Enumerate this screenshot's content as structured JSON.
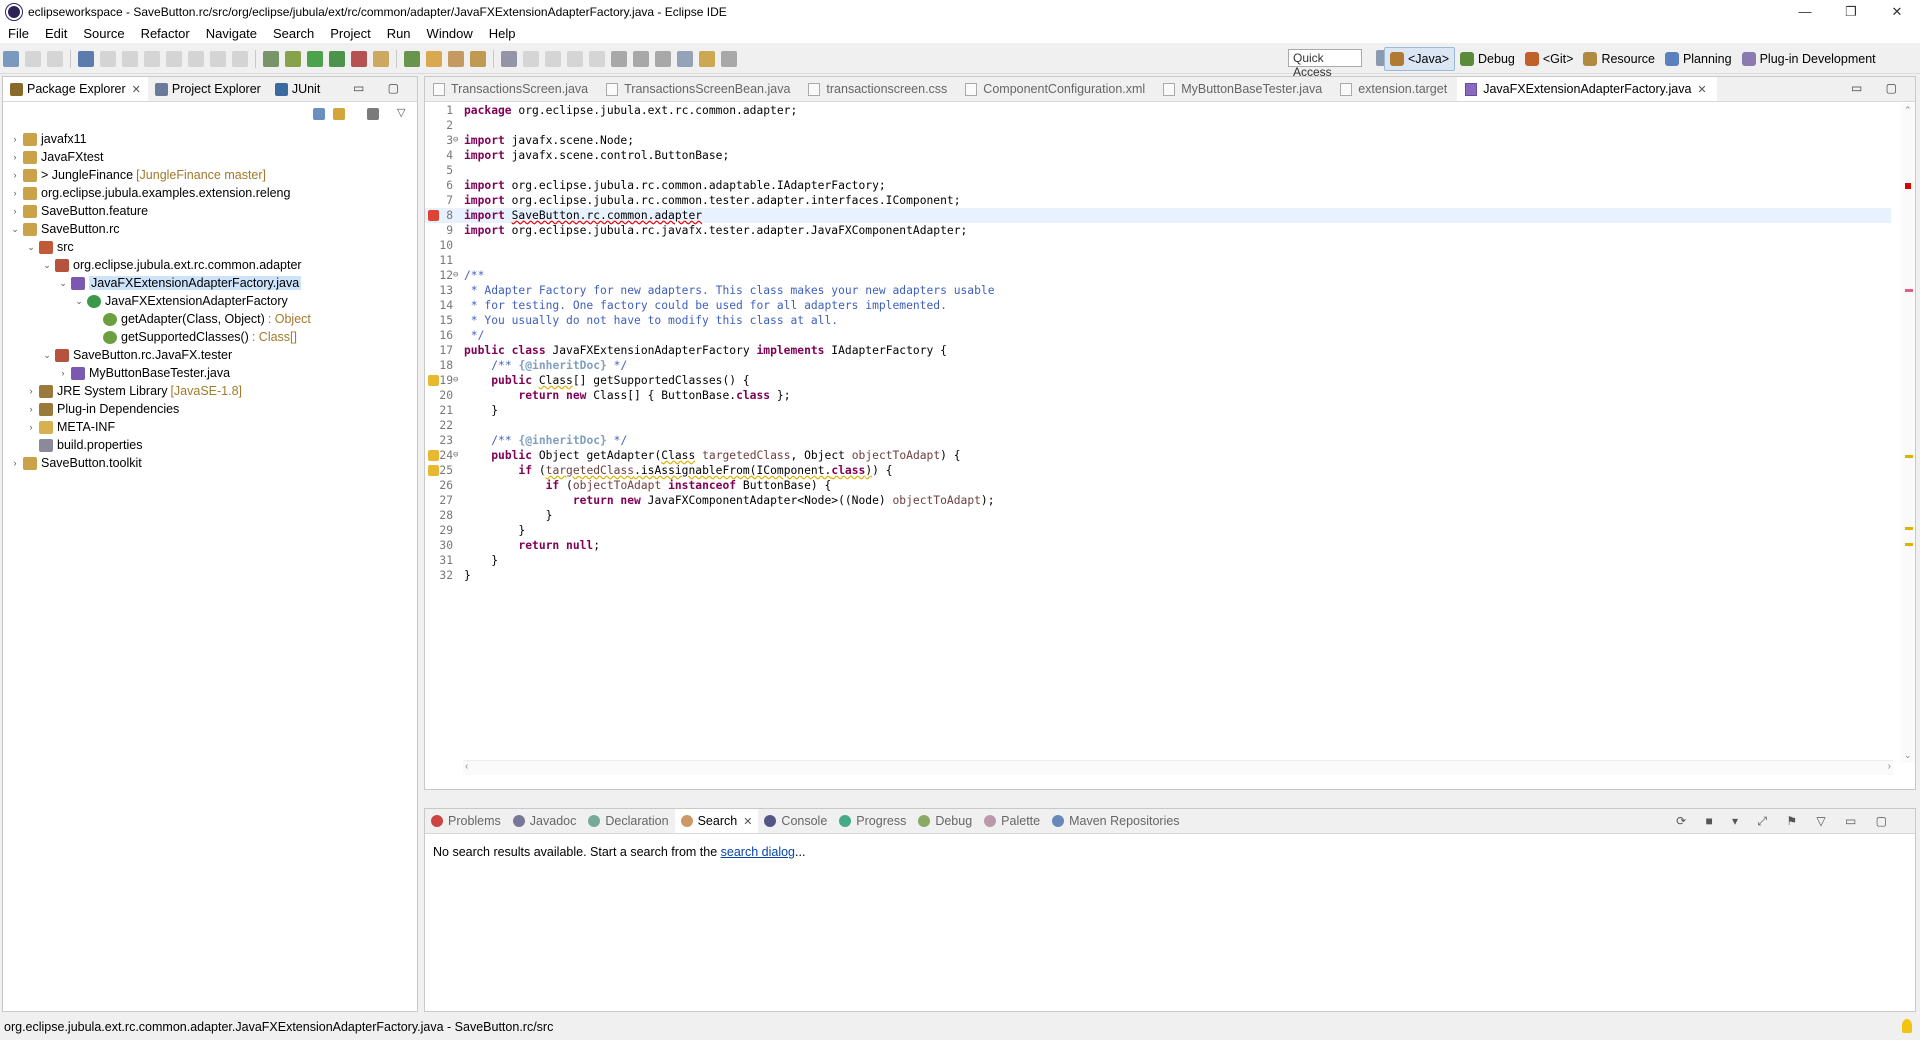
{
  "window": {
    "title": "eclipseworkspace - SaveButton.rc/src/org/eclipse/jubula/ext/rc/common/adapter/JavaFXExtensionAdapterFactory.java - Eclipse IDE"
  },
  "menu": [
    "File",
    "Edit",
    "Source",
    "Refactor",
    "Navigate",
    "Search",
    "Project",
    "Run",
    "Window",
    "Help"
  ],
  "quick_access": "Quick Access",
  "perspectives": [
    {
      "label": "<Java>",
      "icon": "java-perspective-icon",
      "active": true
    },
    {
      "label": "Debug",
      "icon": "debug-perspective-icon",
      "active": false
    },
    {
      "label": "<Git>",
      "icon": "git-perspective-icon",
      "active": false
    },
    {
      "label": "Resource",
      "icon": "resource-perspective-icon",
      "active": false
    },
    {
      "label": "Planning",
      "icon": "planning-perspective-icon",
      "active": false
    },
    {
      "label": "Plug-in Development",
      "icon": "plugin-perspective-icon",
      "active": false
    }
  ],
  "left_tabs": [
    {
      "label": "Package Explorer",
      "active": true,
      "close": "✕"
    },
    {
      "label": "Project Explorer",
      "active": false,
      "close": ""
    },
    {
      "label": "JUnit",
      "active": false,
      "close": ""
    }
  ],
  "tree": [
    {
      "depth": 0,
      "arrow": "›",
      "icon": "project",
      "label": "javafx11",
      "suffix": ""
    },
    {
      "depth": 0,
      "arrow": "›",
      "icon": "project",
      "label": "JavaFXtest",
      "suffix": ""
    },
    {
      "depth": 0,
      "arrow": "›",
      "icon": "project",
      "label": "> JungleFinance",
      "suffix": "[JungleFinance master]"
    },
    {
      "depth": 0,
      "arrow": "›",
      "icon": "project",
      "label": "org.eclipse.jubula.examples.extension.releng",
      "suffix": ""
    },
    {
      "depth": 0,
      "arrow": "›",
      "icon": "project",
      "label": "SaveButton.feature",
      "suffix": ""
    },
    {
      "depth": 0,
      "arrow": "⌄",
      "icon": "project",
      "label": "SaveButton.rc",
      "suffix": ""
    },
    {
      "depth": 1,
      "arrow": "⌄",
      "icon": "srcfolder",
      "label": "src",
      "suffix": ""
    },
    {
      "depth": 2,
      "arrow": "⌄",
      "icon": "package",
      "label": "org.eclipse.jubula.ext.rc.common.adapter",
      "suffix": ""
    },
    {
      "depth": 3,
      "arrow": "⌄",
      "icon": "javafile",
      "label": "JavaFXExtensionAdapterFactory.java",
      "suffix": "",
      "selected": true
    },
    {
      "depth": 4,
      "arrow": "⌄",
      "icon": "class",
      "label": "JavaFXExtensionAdapterFactory",
      "suffix": ""
    },
    {
      "depth": 5,
      "arrow": "",
      "icon": "method",
      "label": "getAdapter(Class, Object)",
      "suffix": ": Object"
    },
    {
      "depth": 5,
      "arrow": "",
      "icon": "method",
      "label": "getSupportedClasses()",
      "suffix": ": Class[]"
    },
    {
      "depth": 2,
      "arrow": "⌄",
      "icon": "package",
      "label": "SaveButton.rc.JavaFX.tester",
      "suffix": ""
    },
    {
      "depth": 3,
      "arrow": "›",
      "icon": "javafile",
      "label": "MyButtonBaseTester.java",
      "suffix": ""
    },
    {
      "depth": 1,
      "arrow": "›",
      "icon": "library",
      "label": "JRE System Library",
      "suffix": "[JavaSE-1.8]"
    },
    {
      "depth": 1,
      "arrow": "›",
      "icon": "library",
      "label": "Plug-in Dependencies",
      "suffix": ""
    },
    {
      "depth": 1,
      "arrow": "›",
      "icon": "folder",
      "label": "META-INF",
      "suffix": ""
    },
    {
      "depth": 1,
      "arrow": "",
      "icon": "file",
      "label": "build.properties",
      "suffix": ""
    },
    {
      "depth": 0,
      "arrow": "›",
      "icon": "project",
      "label": "SaveButton.toolkit",
      "suffix": ""
    }
  ],
  "editor_tabs": [
    {
      "label": "TransactionsScreen.java",
      "active": false
    },
    {
      "label": "TransactionsScreenBean.java",
      "active": false
    },
    {
      "label": "transactionscreen.css",
      "active": false
    },
    {
      "label": "ComponentConfiguration.xml",
      "active": false
    },
    {
      "label": "MyButtonBaseTester.java",
      "active": false
    },
    {
      "label": "extension.target",
      "active": false
    },
    {
      "label": "JavaFXExtensionAdapterFactory.java",
      "active": true
    }
  ],
  "code_lines": [
    {
      "n": "1",
      "fold": "",
      "html": "<span class=\"kw\">package</span> org.eclipse.jubula.ext.rc.common.adapter;"
    },
    {
      "n": "2",
      "fold": "",
      "html": ""
    },
    {
      "n": "3",
      "fold": "⊖",
      "html": "<span class=\"kw\">import</span> javafx.scene.Node;"
    },
    {
      "n": "4",
      "fold": "",
      "html": "<span class=\"kw\">import</span> javafx.scene.control.ButtonBase;"
    },
    {
      "n": "5",
      "fold": "",
      "html": ""
    },
    {
      "n": "6",
      "fold": "",
      "html": "<span class=\"kw\">import</span> org.eclipse.jubula.rc.common.adaptable.IAdapterFactory;"
    },
    {
      "n": "7",
      "fold": "",
      "html": "<span class=\"kw\">import</span> org.eclipse.jubula.rc.common.tester.adapter.interfaces.IComponent;"
    },
    {
      "n": "8",
      "fold": "",
      "marker": "error",
      "current": true,
      "html": "<span class=\"kw\">import</span> <span class=\"err\">SaveButton.rc.common.adapter</span>"
    },
    {
      "n": "9",
      "fold": "",
      "html": "<span class=\"kw\">import</span> org.eclipse.jubula.rc.javafx.tester.adapter.JavaFXComponentAdapter;"
    },
    {
      "n": "10",
      "fold": "",
      "html": ""
    },
    {
      "n": "11",
      "fold": "",
      "html": ""
    },
    {
      "n": "12",
      "fold": "⊖",
      "html": "<span class=\"cm\">/**</span>"
    },
    {
      "n": "13",
      "fold": "",
      "html": "<span class=\"cm\"> * Adapter Factory for new adapters. This class makes your new adapters usable</span>"
    },
    {
      "n": "14",
      "fold": "",
      "html": "<span class=\"cm\"> * for testing. One factory could be used for all adapters implemented.</span>"
    },
    {
      "n": "15",
      "fold": "",
      "html": "<span class=\"cm\"> * You usually do not have to modify this class at all.</span>"
    },
    {
      "n": "16",
      "fold": "",
      "html": "<span class=\"cm\"> */</span>"
    },
    {
      "n": "17",
      "fold": "",
      "html": "<span class=\"kw\">public class</span> JavaFXExtensionAdapterFactory <span class=\"kw\">implements</span> IAdapterFactory {"
    },
    {
      "n": "18",
      "fold": "",
      "html": "    <span class=\"cm\">/** <span class=\"tag\">{@inheritDoc}</span> */</span>"
    },
    {
      "n": "19",
      "fold": "⊖",
      "marker": "warning",
      "html": "    <span class=\"kw\">public</span> <span class=\"wl\">Class</span>[] getSupportedClasses() {"
    },
    {
      "n": "20",
      "fold": "",
      "html": "        <span class=\"kw\">return new</span> Class[] { ButtonBase.<span class=\"kw\">class</span> };"
    },
    {
      "n": "21",
      "fold": "",
      "html": "    }"
    },
    {
      "n": "22",
      "fold": "",
      "html": ""
    },
    {
      "n": "23",
      "fold": "",
      "html": "    <span class=\"cm\">/** <span class=\"tag\">{@inheritDoc}</span> */</span>"
    },
    {
      "n": "24",
      "fold": "⊖",
      "marker": "warning",
      "html": "    <span class=\"kw\">public</span> Object getAdapter(<span class=\"wl\">Class</span> <span class=\"fd\">targetedClass</span>, Object <span class=\"fd\">objectToAdapt</span>) {"
    },
    {
      "n": "25",
      "fold": "",
      "marker": "warning",
      "html": "        <span class=\"kw\">if</span> (<span class=\"wl\"><span class=\"fd\">targetedClass</span>.isAssignableFrom(IComponent.<span class=\"kw\">class</span>)</span>) {"
    },
    {
      "n": "26",
      "fold": "",
      "html": "            <span class=\"kw\">if</span> (<span class=\"fd\">objectToAdapt</span> <span class=\"kw\">instanceof</span> ButtonBase) {"
    },
    {
      "n": "27",
      "fold": "",
      "html": "                <span class=\"kw\">return new</span> JavaFXComponentAdapter&lt;Node&gt;((Node) <span class=\"fd\">objectToAdapt</span>);"
    },
    {
      "n": "28",
      "fold": "",
      "html": "            }"
    },
    {
      "n": "29",
      "fold": "",
      "html": "        }"
    },
    {
      "n": "30",
      "fold": "",
      "html": "        <span class=\"kw\">return null</span>;"
    },
    {
      "n": "31",
      "fold": "",
      "html": "    }"
    },
    {
      "n": "32",
      "fold": "",
      "html": "}"
    }
  ],
  "bottom_tabs": [
    {
      "label": "Problems",
      "active": false,
      "color": "#c44"
    },
    {
      "label": "Javadoc",
      "active": false,
      "color": "#779"
    },
    {
      "label": "Declaration",
      "active": false,
      "color": "#7a9"
    },
    {
      "label": "Search",
      "active": true,
      "color": "#c96"
    },
    {
      "label": "Console",
      "active": false,
      "color": "#558"
    },
    {
      "label": "Progress",
      "active": false,
      "color": "#4a8"
    },
    {
      "label": "Debug",
      "active": false,
      "color": "#8a6"
    },
    {
      "label": "Palette",
      "active": false,
      "color": "#b9a"
    },
    {
      "label": "Maven Repositories",
      "active": false,
      "color": "#68b"
    }
  ],
  "search_view": {
    "message_prefix": "No search results available. Start a search from the ",
    "link": "search dialog",
    "message_suffix": "..."
  },
  "status_bar": "org.eclipse.jubula.ext.rc.common.adapter.JavaFXExtensionAdapterFactory.java - SaveButton.rc/src",
  "colors": {
    "accent": "#dbe6f5",
    "selection": "#cde3fa",
    "keyword": "#7f0055",
    "comment": "#3f5fbf",
    "error": "#e00000",
    "warning": "#e0b000"
  }
}
